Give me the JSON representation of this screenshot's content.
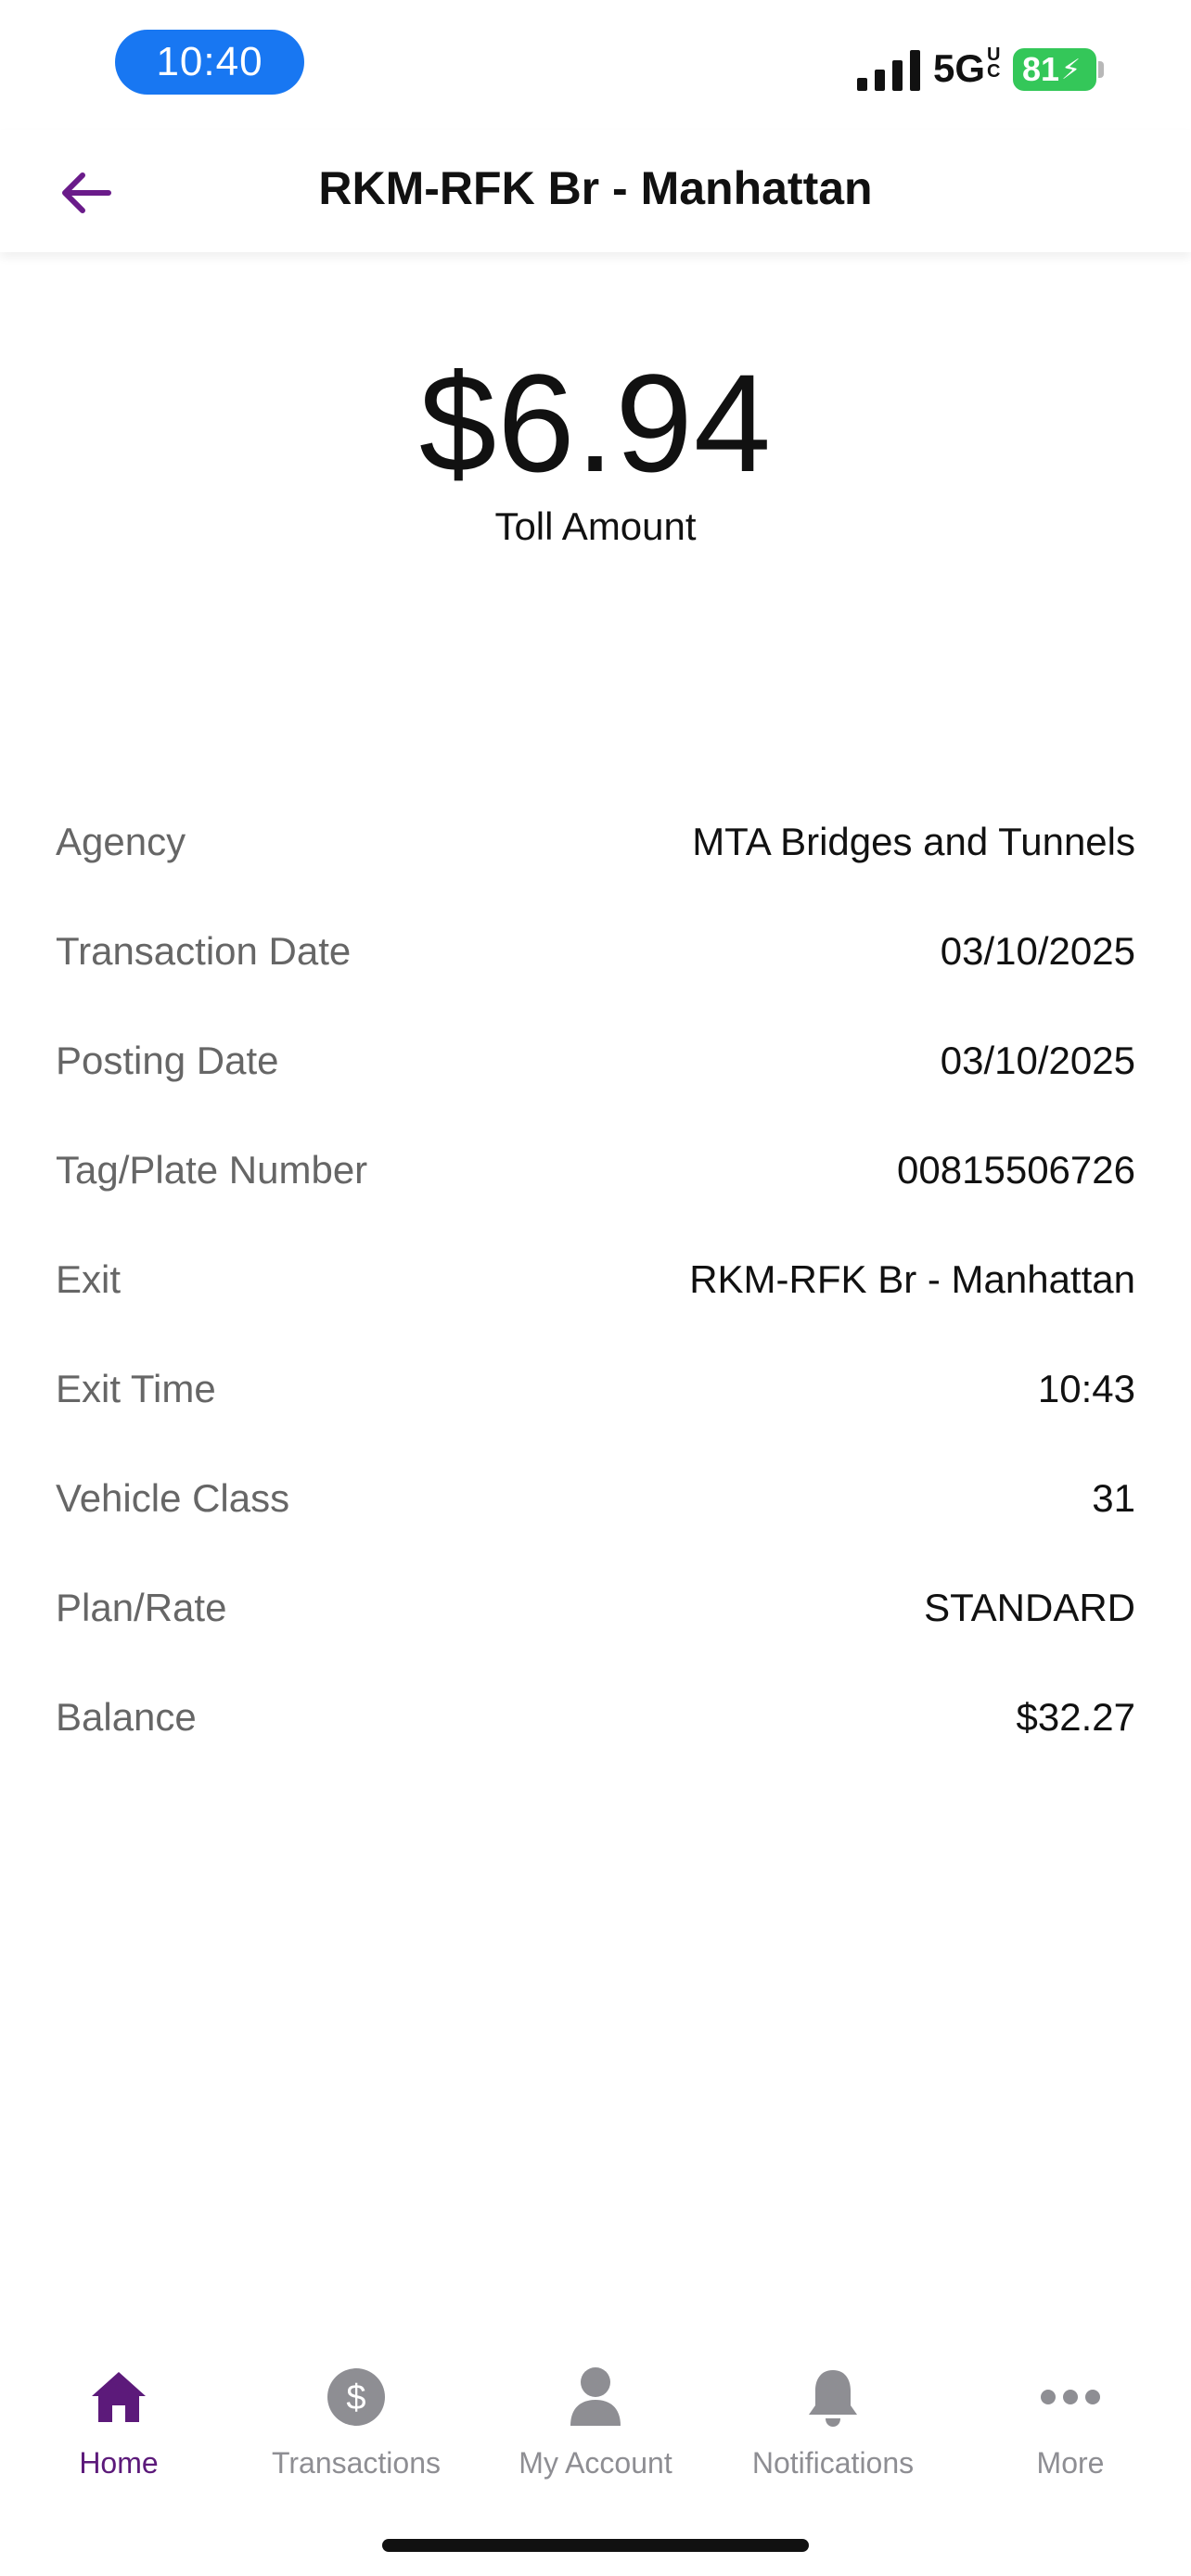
{
  "status_bar": {
    "time": "10:40",
    "network": "5G",
    "network_sup": "UC",
    "battery": "81"
  },
  "header": {
    "title": "RKM-RFK Br - Manhattan"
  },
  "toll": {
    "amount": "$6.94",
    "label": "Toll Amount"
  },
  "details": [
    {
      "label": "Agency",
      "value": "MTA Bridges and Tunnels"
    },
    {
      "label": "Transaction Date",
      "value": "03/10/2025"
    },
    {
      "label": "Posting Date",
      "value": "03/10/2025"
    },
    {
      "label": "Tag/Plate Number",
      "value": "00815506726"
    },
    {
      "label": "Exit",
      "value": "RKM-RFK Br - Manhattan"
    },
    {
      "label": "Exit Time",
      "value": "10:43"
    },
    {
      "label": "Vehicle Class",
      "value": "31"
    },
    {
      "label": "Plan/Rate",
      "value": "STANDARD"
    },
    {
      "label": "Balance",
      "value": "$32.27"
    }
  ],
  "tabs": [
    {
      "label": "Home",
      "icon": "home-icon",
      "active": true
    },
    {
      "label": "Transactions",
      "icon": "dollar-icon",
      "active": false
    },
    {
      "label": "My Account",
      "icon": "person-icon",
      "active": false
    },
    {
      "label": "Notifications",
      "icon": "bell-icon",
      "active": false
    },
    {
      "label": "More",
      "icon": "more-icon",
      "active": false
    }
  ],
  "colors": {
    "accent": "#5c1a7a",
    "inactive": "#8e8e93",
    "time_pill": "#1877f2",
    "battery": "#34c759"
  }
}
